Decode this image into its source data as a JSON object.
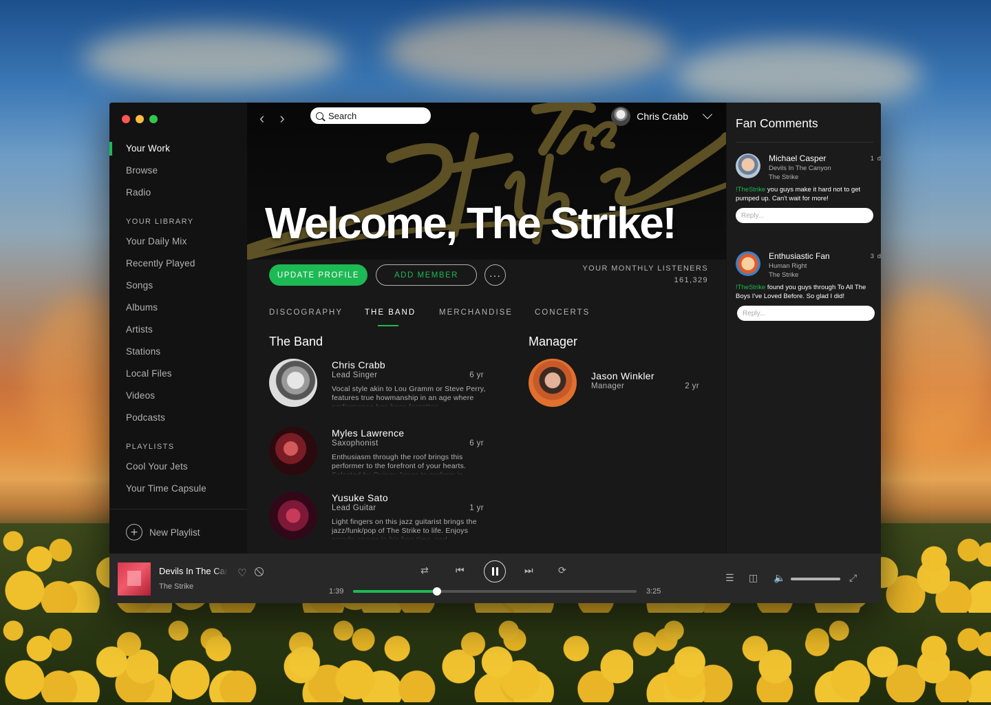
{
  "sidebar": {
    "nav": [
      "Your Work",
      "Browse",
      "Radio"
    ],
    "library_label": "YOUR LIBRARY",
    "library": [
      "Your Daily Mix",
      "Recently Played",
      "Songs",
      "Albums",
      "Artists",
      "Stations",
      "Local Files",
      "Videos",
      "Podcasts"
    ],
    "playlists_label": "PLAYLISTS",
    "playlists": [
      "Cool Your Jets",
      "Your Time Capsule"
    ],
    "new_playlist": "New Playlist"
  },
  "header": {
    "search_placeholder": "Search",
    "user_name": "Chris Crabb",
    "welcome": "Welcome, The Strike!"
  },
  "actions": {
    "update_profile": "UPDATE PROFILE",
    "add_member": "ADD MEMBER",
    "more": "···"
  },
  "listeners": {
    "label": "YOUR MONTHLY LISTENERS",
    "count": "161,329"
  },
  "tabs": [
    "DISCOGRAPHY",
    "THE BAND",
    "MERCHANDISE",
    "CONCERTS"
  ],
  "active_tab": "THE BAND",
  "band": {
    "title": "The Band",
    "members": [
      {
        "name": "Chris Crabb",
        "role": "Lead Singer",
        "years": "6 yr",
        "bio": "Vocal style akin to Lou Gramm or Steve Perry, features true howmanship in an age where performance has been forgotten."
      },
      {
        "name": "Myles Lawrence",
        "role": "Saxophonist",
        "years": "6 yr",
        "bio": "Enthusiasm through the roof brings this performer to the forefront of your hearts. Selected by Quincy Jones to perform in"
      },
      {
        "name": "Yusuke Sato",
        "role": "Lead Guitar",
        "years": "1 yr",
        "bio": "Light fingers on this jazz guitarist brings the jazz/funk/pop of The Strike to life. Enjoys arcade games in his free time, and"
      }
    ]
  },
  "manager": {
    "title": "Manager",
    "name": "Jason Winkler",
    "role": "Manager",
    "years": "2 yr"
  },
  "fan_comments": {
    "title": "Fan Comments",
    "items": [
      {
        "name": "Michael Casper",
        "time": "1 d",
        "sub1": "Devils In The Canyon",
        "sub2": "The Strike",
        "tag": "!TheStrike",
        "text": " you guys make it hard not to get pumped up. Can't wait for more!",
        "reply_placeholder": "Reply..."
      },
      {
        "name": "Enthusiastic Fan",
        "time": "3 d",
        "sub1": "Human Right",
        "sub2": "The Strike",
        "tag": "!TheStrike",
        "text": " found you guys through To All The Boys I've Loved Before. So glad I did!",
        "reply_placeholder": "Reply..."
      }
    ]
  },
  "player": {
    "track_title": "Devils In The Canyon",
    "artist": "The Strike",
    "elapsed": "1:39",
    "duration": "3:25",
    "progress_fraction": 0.297,
    "volume_fraction": 1.0
  },
  "colors": {
    "accent": "#1db954",
    "panel": "#181818",
    "sidebar": "#121212",
    "player": "#282828"
  }
}
